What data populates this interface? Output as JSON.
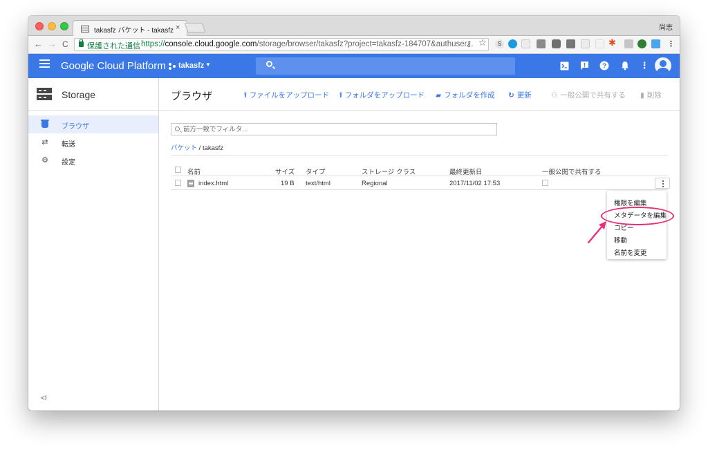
{
  "browser": {
    "tab": {
      "title": "takasfz バケット - takasfz",
      "close": "×"
    },
    "profile": "尚志",
    "nav": {
      "back": "←",
      "forward": "→",
      "reload": "C"
    },
    "secure_label": "保護された通信",
    "url": {
      "scheme": "https://",
      "host": "console.cloud.google.com",
      "path": "/storage/browser/takasfz?project=takasfz-184707&authuser..."
    }
  },
  "header": {
    "title": "Google Cloud Platform",
    "project": "takasfz",
    "accent": "#3b78e7"
  },
  "sidebar": {
    "title": "Storage",
    "items": [
      {
        "label": "ブラウザ",
        "icon": "bucket-icon",
        "active": true
      },
      {
        "label": "転送",
        "icon": "transfer-icon",
        "active": false
      },
      {
        "label": "設定",
        "icon": "gear-icon",
        "active": false
      }
    ],
    "collapse": "<I"
  },
  "main": {
    "title": "ブラウザ",
    "toolbar": {
      "upload_files": "ファイルをアップロード",
      "upload_folder": "フォルダをアップロード",
      "create_folder": "フォルダを作成",
      "refresh": "更新",
      "share_publicly": "一般公開で共有する",
      "delete": "削除"
    },
    "filter_placeholder": "前方一致でフィルタ...",
    "breadcrumb": {
      "root": "バケット",
      "separator": "/",
      "current": "takasfz"
    },
    "table": {
      "headers": {
        "name": "名前",
        "size": "サイズ",
        "type": "タイプ",
        "storage_class": "ストレージ クラス",
        "updated": "最終更新日",
        "public": "一般公開で共有する"
      },
      "rows": [
        {
          "name": "index.html",
          "size": "19 B",
          "type": "text/html",
          "storage_class": "Regional",
          "updated": "2017/11/02 17:53"
        }
      ]
    }
  },
  "context_menu": {
    "items": [
      "権限を編集",
      "メタデータを編集",
      "コピー",
      "移動",
      "名前を変更"
    ],
    "highlighted": "メタデータを編集",
    "highlight_color": "#e8307a"
  }
}
